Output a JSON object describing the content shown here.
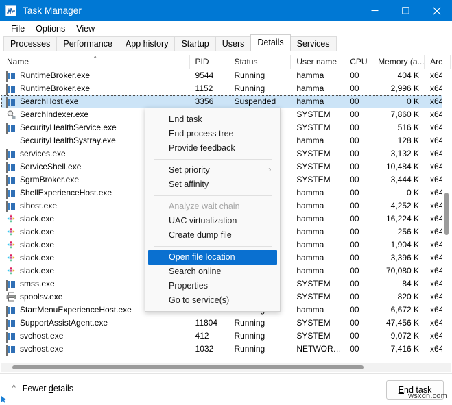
{
  "window": {
    "title": "Task Manager",
    "icon": "task-manager-icon",
    "controls": {
      "minimize": "–",
      "maximize": "☐",
      "close": "✕"
    }
  },
  "menubar": {
    "items": [
      "File",
      "Options",
      "View"
    ]
  },
  "tabs": [
    {
      "label": "Processes",
      "active": false
    },
    {
      "label": "Performance",
      "active": false
    },
    {
      "label": "App history",
      "active": false
    },
    {
      "label": "Startup",
      "active": false
    },
    {
      "label": "Users",
      "active": false
    },
    {
      "label": "Details",
      "active": true
    },
    {
      "label": "Services",
      "active": false
    }
  ],
  "table": {
    "sort_column": "Name",
    "sort_direction": "ascending",
    "columns": [
      {
        "key": "name",
        "label": "Name",
        "align": "left"
      },
      {
        "key": "pid",
        "label": "PID",
        "align": "left"
      },
      {
        "key": "status",
        "label": "Status",
        "align": "left"
      },
      {
        "key": "user",
        "label": "User name",
        "align": "left"
      },
      {
        "key": "cpu",
        "label": "CPU",
        "align": "left"
      },
      {
        "key": "memory",
        "label": "Memory (a...",
        "align": "right"
      },
      {
        "key": "arch",
        "label": "Arc",
        "align": "left"
      }
    ],
    "rows": [
      {
        "icon": "window-icon",
        "name": "RuntimeBroker.exe",
        "pid": "9544",
        "status": "Running",
        "user": "hamma",
        "cpu": "00",
        "memory": "404 K",
        "arch": "x64",
        "selected": false
      },
      {
        "icon": "window-icon",
        "name": "RuntimeBroker.exe",
        "pid": "1152",
        "status": "Running",
        "user": "hamma",
        "cpu": "00",
        "memory": "2,996 K",
        "arch": "x64",
        "selected": false
      },
      {
        "icon": "window-icon",
        "name": "SearchHost.exe",
        "pid": "3356",
        "status": "Suspended",
        "user": "hamma",
        "cpu": "00",
        "memory": "0 K",
        "arch": "x64",
        "selected": true
      },
      {
        "icon": "magnifier-icon",
        "name": "SearchIndexer.exe",
        "pid": "",
        "status": "",
        "user": "SYSTEM",
        "cpu": "00",
        "memory": "7,860 K",
        "arch": "x64",
        "selected": false
      },
      {
        "icon": "window-icon",
        "name": "SecurityHealthService.exe",
        "pid": "",
        "status": "",
        "user": "SYSTEM",
        "cpu": "00",
        "memory": "516 K",
        "arch": "x64",
        "selected": false
      },
      {
        "icon": "shield-icon",
        "name": "SecurityHealthSystray.exe",
        "pid": "",
        "status": "",
        "user": "hamma",
        "cpu": "00",
        "memory": "128 K",
        "arch": "x64",
        "selected": false
      },
      {
        "icon": "window-icon",
        "name": "services.exe",
        "pid": "",
        "status": "",
        "user": "SYSTEM",
        "cpu": "00",
        "memory": "3,132 K",
        "arch": "x64",
        "selected": false
      },
      {
        "icon": "window-icon",
        "name": "ServiceShell.exe",
        "pid": "",
        "status": "",
        "user": "SYSTEM",
        "cpu": "00",
        "memory": "10,484 K",
        "arch": "x64",
        "selected": false
      },
      {
        "icon": "window-icon",
        "name": "SgrmBroker.exe",
        "pid": "",
        "status": "",
        "user": "SYSTEM",
        "cpu": "00",
        "memory": "3,444 K",
        "arch": "x64",
        "selected": false
      },
      {
        "icon": "window-icon",
        "name": "ShellExperienceHost.exe",
        "pid": "",
        "status": "",
        "user": "hamma",
        "cpu": "00",
        "memory": "0 K",
        "arch": "x64",
        "selected": false
      },
      {
        "icon": "window-icon",
        "name": "sihost.exe",
        "pid": "",
        "status": "",
        "user": "hamma",
        "cpu": "00",
        "memory": "4,252 K",
        "arch": "x64",
        "selected": false
      },
      {
        "icon": "slack-icon",
        "name": "slack.exe",
        "pid": "",
        "status": "",
        "user": "hamma",
        "cpu": "00",
        "memory": "16,224 K",
        "arch": "x64",
        "selected": false
      },
      {
        "icon": "slack-icon",
        "name": "slack.exe",
        "pid": "",
        "status": "",
        "user": "hamma",
        "cpu": "00",
        "memory": "256 K",
        "arch": "x64",
        "selected": false
      },
      {
        "icon": "slack-icon",
        "name": "slack.exe",
        "pid": "",
        "status": "",
        "user": "hamma",
        "cpu": "00",
        "memory": "1,904 K",
        "arch": "x64",
        "selected": false
      },
      {
        "icon": "slack-icon",
        "name": "slack.exe",
        "pid": "",
        "status": "",
        "user": "hamma",
        "cpu": "00",
        "memory": "3,396 K",
        "arch": "x64",
        "selected": false
      },
      {
        "icon": "slack-icon",
        "name": "slack.exe",
        "pid": "",
        "status": "",
        "user": "hamma",
        "cpu": "00",
        "memory": "70,080 K",
        "arch": "x64",
        "selected": false
      },
      {
        "icon": "window-icon",
        "name": "smss.exe",
        "pid": "",
        "status": "",
        "user": "SYSTEM",
        "cpu": "00",
        "memory": "84 K",
        "arch": "x64",
        "selected": false
      },
      {
        "icon": "printer-icon",
        "name": "spoolsv.exe",
        "pid": "",
        "status": "",
        "user": "SYSTEM",
        "cpu": "00",
        "memory": "820 K",
        "arch": "x64",
        "selected": false
      },
      {
        "icon": "window-icon",
        "name": "StartMenuExperienceHost.exe",
        "pid": "9228",
        "status": "Running",
        "user": "hamma",
        "cpu": "00",
        "memory": "6,672 K",
        "arch": "x64",
        "selected": false
      },
      {
        "icon": "window-icon",
        "name": "SupportAssistAgent.exe",
        "pid": "11804",
        "status": "Running",
        "user": "SYSTEM",
        "cpu": "00",
        "memory": "47,456 K",
        "arch": "x64",
        "selected": false
      },
      {
        "icon": "window-icon",
        "name": "svchost.exe",
        "pid": "412",
        "status": "Running",
        "user": "SYSTEM",
        "cpu": "00",
        "memory": "9,072 K",
        "arch": "x64",
        "selected": false
      },
      {
        "icon": "window-icon",
        "name": "svchost.exe",
        "pid": "1032",
        "status": "Running",
        "user": "NETWORK...",
        "cpu": "00",
        "memory": "7,416 K",
        "arch": "x64",
        "selected": false
      }
    ]
  },
  "context_menu": {
    "items": [
      {
        "label": "End task",
        "type": "item",
        "state": "normal"
      },
      {
        "label": "End process tree",
        "type": "item",
        "state": "normal"
      },
      {
        "label": "Provide feedback",
        "type": "item",
        "state": "normal"
      },
      {
        "label": "",
        "type": "separator",
        "state": "normal"
      },
      {
        "label": "Set priority",
        "type": "submenu",
        "state": "normal",
        "chevron": "›"
      },
      {
        "label": "Set affinity",
        "type": "item",
        "state": "normal"
      },
      {
        "label": "",
        "type": "separator",
        "state": "normal"
      },
      {
        "label": "Analyze wait chain",
        "type": "item",
        "state": "disabled"
      },
      {
        "label": "UAC virtualization",
        "type": "item",
        "state": "normal"
      },
      {
        "label": "Create dump file",
        "type": "item",
        "state": "normal"
      },
      {
        "label": "",
        "type": "separator",
        "state": "normal"
      },
      {
        "label": "Open file location",
        "type": "item",
        "state": "highlighted"
      },
      {
        "label": "Search online",
        "type": "item",
        "state": "normal"
      },
      {
        "label": "Properties",
        "type": "item",
        "state": "normal"
      },
      {
        "label": "Go to service(s)",
        "type": "item",
        "state": "normal"
      }
    ]
  },
  "footer": {
    "fewer_details": "Fewer details",
    "fewer_details_pre": "Fewer ",
    "fewer_details_accel": "d",
    "fewer_details_post": "etails",
    "end_task_pre": "E",
    "end_task_accel": "",
    "end_task_post": "nd task",
    "end_task": "End task"
  },
  "watermark": "wsxdn.com",
  "colors": {
    "titlebar": "#0078d4",
    "selection": "#cce4f7",
    "menu_highlight": "#0a70d0",
    "shield": "#1f7fd4"
  }
}
